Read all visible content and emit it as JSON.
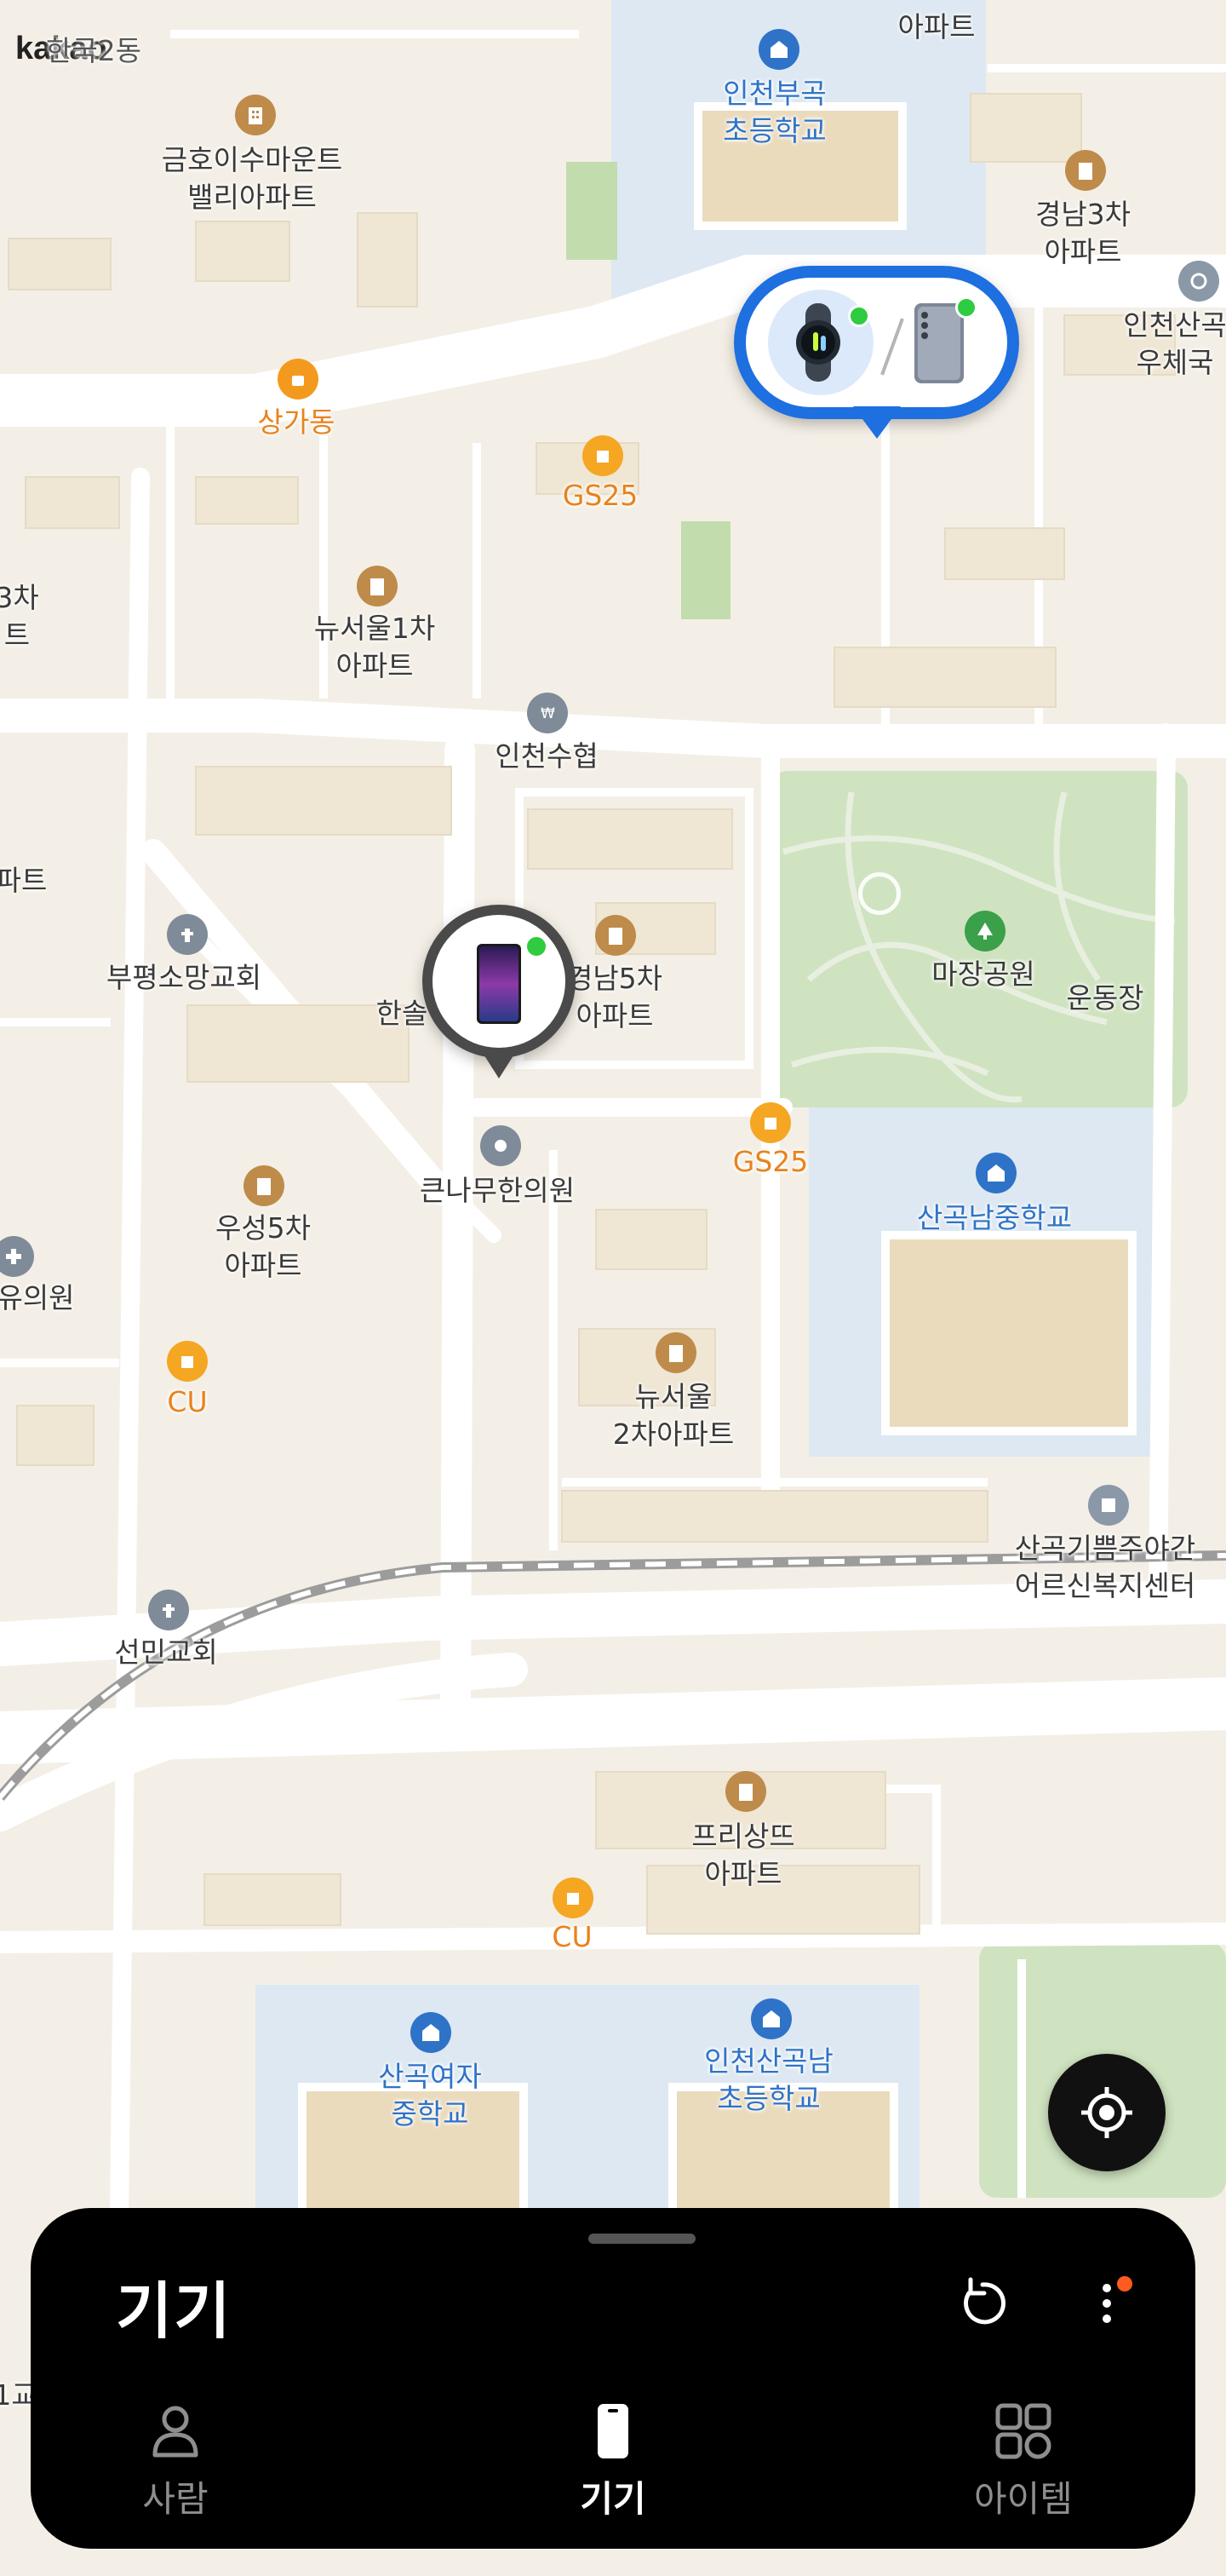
{
  "map": {
    "brand": "kakao",
    "partial_label": "한국2동",
    "labels": {
      "geumho": "금호이수마운트\n밸리아파트",
      "bugok": "인천부곡\n초등학교",
      "gyeongnam3": "경남3차\n아파트",
      "sangadong": "상가동",
      "gs25_a": "GS25",
      "newseoul1": "뉴서울1차\n아파트",
      "incheon_suhyup": "인천수협",
      "bupyeong_church": "부평소망교회",
      "hansol": "한솔",
      "gyeongnam5": "경남5차\n아파트",
      "majang": "마장공원",
      "stadium": "운동장",
      "gs25_b": "GS25",
      "keunnamu": "큰나무한의원",
      "woosung5": "우성5차\n아파트",
      "sangok_ms": "산곡남중학교",
      "yuuiwon": "유의원",
      "cu_a": "CU",
      "newseoul2": "뉴서울\n2차아파트",
      "gippeum": "산곡기쁨주야간\n어르신복지센터",
      "seonmin": "선민교회",
      "freesangtteu": "프리상뜨\n아파트",
      "cu_b": "CU",
      "girls_ms": "산곡여자\n중학교",
      "sangoknam_es": "인천산곡남\n초등학교",
      "post_office": "인천산곡\n우체국",
      "left_apt": "3차\n트",
      "left_apt2": "파트",
      "bottom_left": "1교",
      "top_apt": "아파트"
    }
  },
  "bottom_sheet": {
    "title": "기기",
    "tabs": [
      {
        "label": "사람",
        "icon": "person-icon",
        "active": false
      },
      {
        "label": "기기",
        "icon": "phone-icon",
        "active": true
      },
      {
        "label": "아이템",
        "icon": "grid-icon",
        "active": false
      }
    ]
  },
  "colors": {
    "accent": "#1e6fe0",
    "online_dot": "#2ecc40",
    "notification_dot": "#ff5a1f",
    "sheet_bg": "#000000"
  }
}
